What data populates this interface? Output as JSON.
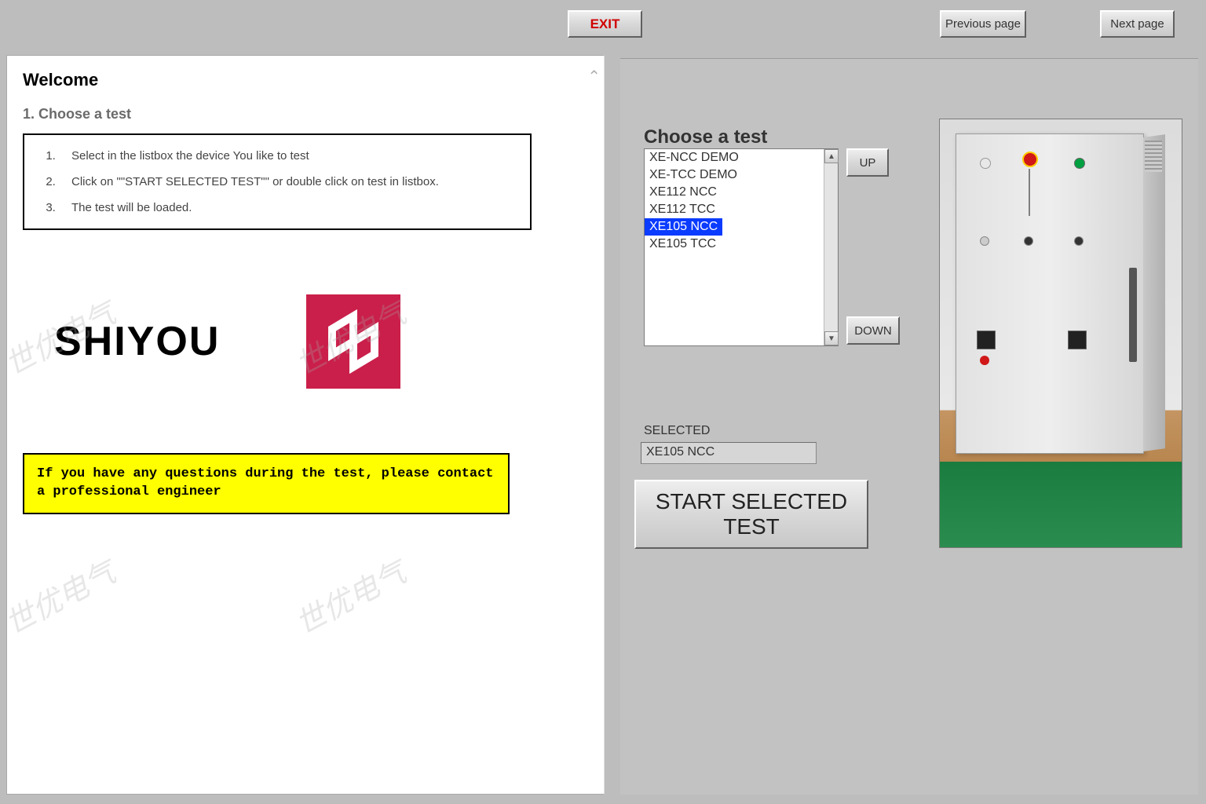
{
  "topbar": {
    "exit": "EXIT",
    "prev": "Previous page",
    "next": "Next page"
  },
  "left": {
    "title": "Welcome",
    "step_heading": "1. Choose a test",
    "instructions": [
      "Select in the listbox the device You like to test",
      "Click on \"\"START SELECTED TEST\"\" or double click on test in listbox.",
      "The test will be loaded."
    ],
    "brand": "SHIYOU",
    "warning": "If you have any questions during the test, please contact a professional engineer"
  },
  "right": {
    "choose_label": "Choose a test",
    "list": [
      "XE-NCC DEMO",
      "XE-TCC DEMO",
      "XE112 NCC",
      "XE112 TCC",
      "XE105 NCC",
      "XE105 TCC"
    ],
    "selected_index": 4,
    "up": "UP",
    "down": "DOWN",
    "selected_label": "SELECTED",
    "selected_value": "XE105 NCC",
    "start": "START SELECTED TEST"
  },
  "watermark_text": "世优电气"
}
